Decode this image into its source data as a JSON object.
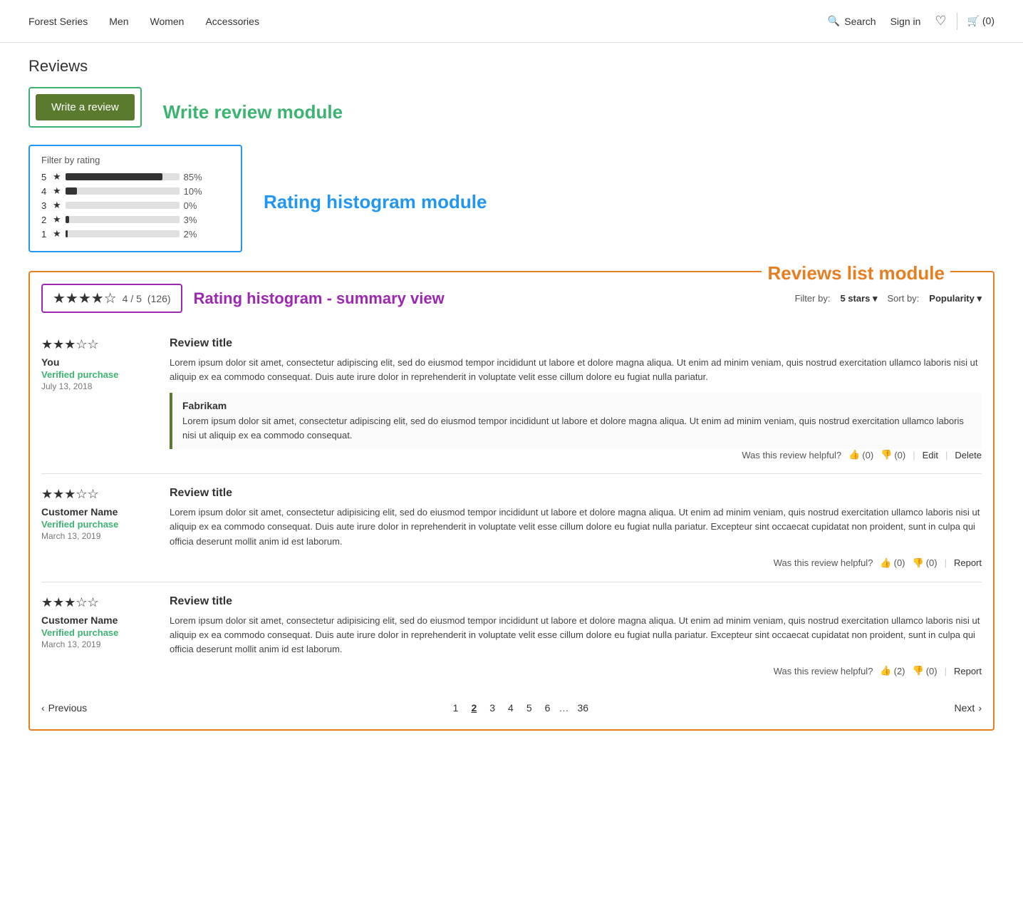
{
  "nav": {
    "items": [
      "Forest Series",
      "Men",
      "Women",
      "Accessories"
    ],
    "search_label": "Search",
    "signin_label": "Sign in",
    "cart_count": "0"
  },
  "page": {
    "title": "Reviews",
    "module_label_write": "Write review module",
    "module_label_histogram": "Rating histogram module",
    "module_label_reviews_list": "Reviews list module",
    "module_label_summary": "Rating histogram - summary view"
  },
  "write_review": {
    "button_label": "Write a review"
  },
  "histogram": {
    "filter_label": "Filter by rating",
    "rows": [
      {
        "num": "5",
        "pct_val": 85,
        "pct_label": "85%"
      },
      {
        "num": "4",
        "pct_val": 10,
        "pct_label": "10%"
      },
      {
        "num": "3",
        "pct_val": 0,
        "pct_label": "0%"
      },
      {
        "num": "2",
        "pct_val": 3,
        "pct_label": "3%"
      },
      {
        "num": "1",
        "pct_val": 2,
        "pct_label": "2%"
      }
    ]
  },
  "summary": {
    "score": "4 / 5",
    "count": "(126)",
    "filter_label": "Filter by:",
    "filter_value": "5 stars ▾",
    "sort_label": "Sort by:",
    "sort_value": "Popularity ▾"
  },
  "reviews": [
    {
      "stars": 3,
      "reviewer": "You",
      "verified": "Verified purchase",
      "date": "July 13, 2018",
      "title": "Review title",
      "body": "Lorem ipsum dolor sit amet, consectetur adipiscing elit, sed do eiusmod tempor incididunt ut labore et dolore magna aliqua. Ut enim ad minim veniam, quis nostrud exercitation ullamco laboris nisi ut aliquip ex ea commodo consequat. Duis aute irure dolor in reprehenderit in voluptate velit esse cillum dolore eu fugiat nulla pariatur.",
      "helpful_label": "Was this review helpful?",
      "thumbs_up": "0",
      "thumbs_down": "0",
      "actions": [
        "Edit",
        "Delete"
      ],
      "reply": {
        "name": "Fabrikam",
        "body": "Lorem ipsum dolor sit amet, consectetur adipiscing elit, sed do eiusmod tempor incididunt ut labore et dolore magna aliqua. Ut enim ad minim veniam, quis nostrud exercitation ullamco laboris nisi ut aliquip ex ea commodo consequat."
      }
    },
    {
      "stars": 3,
      "reviewer": "Customer Name",
      "verified": "Verified purchase",
      "date": "March 13, 2019",
      "title": "Review title",
      "body": "Lorem ipsum dolor sit amet, consectetur adipisicing elit, sed do eiusmod tempor incididunt ut labore et dolore magna aliqua. Ut enim ad minim veniam, quis nostrud exercitation ullamco laboris nisi ut aliquip ex ea commodo consequat. Duis aute irure dolor in reprehenderit in voluptate velit esse cillum dolore eu fugiat nulla pariatur. Excepteur sint occaecat cupidatat non proident, sunt in culpa qui officia deserunt mollit anim id est laborum.",
      "helpful_label": "Was this review helpful?",
      "thumbs_up": "0",
      "thumbs_down": "0",
      "actions": [
        "Report"
      ],
      "reply": null
    },
    {
      "stars": 3,
      "reviewer": "Customer Name",
      "verified": "Verified purchase",
      "date": "March 13, 2019",
      "title": "Review title",
      "body": "Lorem ipsum dolor sit amet, consectetur adipisicing elit, sed do eiusmod tempor incididunt ut labore et dolore magna aliqua. Ut enim ad minim veniam, quis nostrud exercitation ullamco laboris nisi ut aliquip ex ea commodo consequat. Duis aute irure dolor in reprehenderit in voluptate velit esse cillum dolore eu fugiat nulla pariatur. Excepteur sint occaecat cupidatat non proident, sunt in culpa qui officia deserunt mollit anim id est laborum.",
      "helpful_label": "Was this review helpful?",
      "thumbs_up": "2",
      "thumbs_down": "0",
      "actions": [
        "Report"
      ],
      "reply": null
    }
  ],
  "pagination": {
    "prev_label": "Previous",
    "next_label": "Next",
    "pages": [
      "1",
      "2",
      "3",
      "4",
      "5",
      "6"
    ],
    "last_page": "36",
    "active_page": "2"
  }
}
